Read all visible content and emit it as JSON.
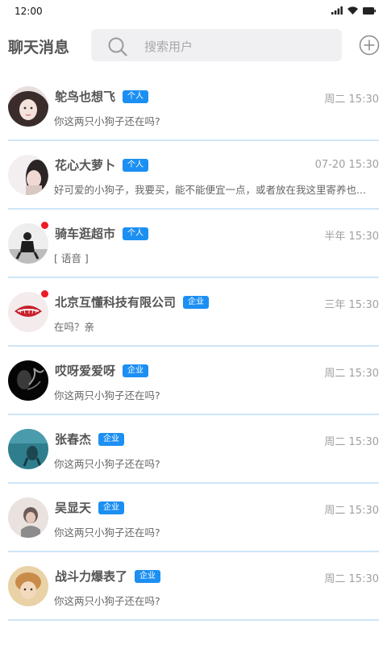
{
  "status_bar": {
    "time": "12:00"
  },
  "header": {
    "title": "聊天消息",
    "search_placeholder": "搜索用户"
  },
  "colors": {
    "accent": "#1c8ff2",
    "divider": "#cfe5f6",
    "unread": "#ee1b24"
  },
  "chats": [
    {
      "name": "鸵鸟也想飞",
      "tag": "个人",
      "time": "周二 15:30",
      "preview": "你这两只小狗子还在吗?",
      "unread": false
    },
    {
      "name": "花心大萝卜",
      "tag": "个人",
      "time": "07-20 15:30",
      "preview": "好可爱的小狗子，我要买，能不能便宜一点，或者放在我这里寄养也...",
      "unread": false
    },
    {
      "name": "骑车逛超市",
      "tag": "个人",
      "time": "半年 15:30",
      "preview": "[ 语音 ]",
      "unread": true
    },
    {
      "name": "北京互懂科技有限公司",
      "tag": "企业",
      "time": "三年 15:30",
      "preview": "在吗？亲",
      "unread": true
    },
    {
      "name": "哎呀爱爱呀",
      "tag": "企业",
      "time": "周二 15:30",
      "preview": "你这两只小狗子还在吗?",
      "unread": false
    },
    {
      "name": "张春杰",
      "tag": "企业",
      "time": "周二 15:30",
      "preview": "你这两只小狗子还在吗?",
      "unread": false
    },
    {
      "name": "吴显天",
      "tag": "企业",
      "time": "周二 15:30",
      "preview": "你这两只小狗子还在吗?",
      "unread": false
    },
    {
      "name": "战斗力爆表了",
      "tag": "企业",
      "time": "周二 15:30",
      "preview": "你这两只小狗子还在吗?",
      "unread": false
    }
  ]
}
